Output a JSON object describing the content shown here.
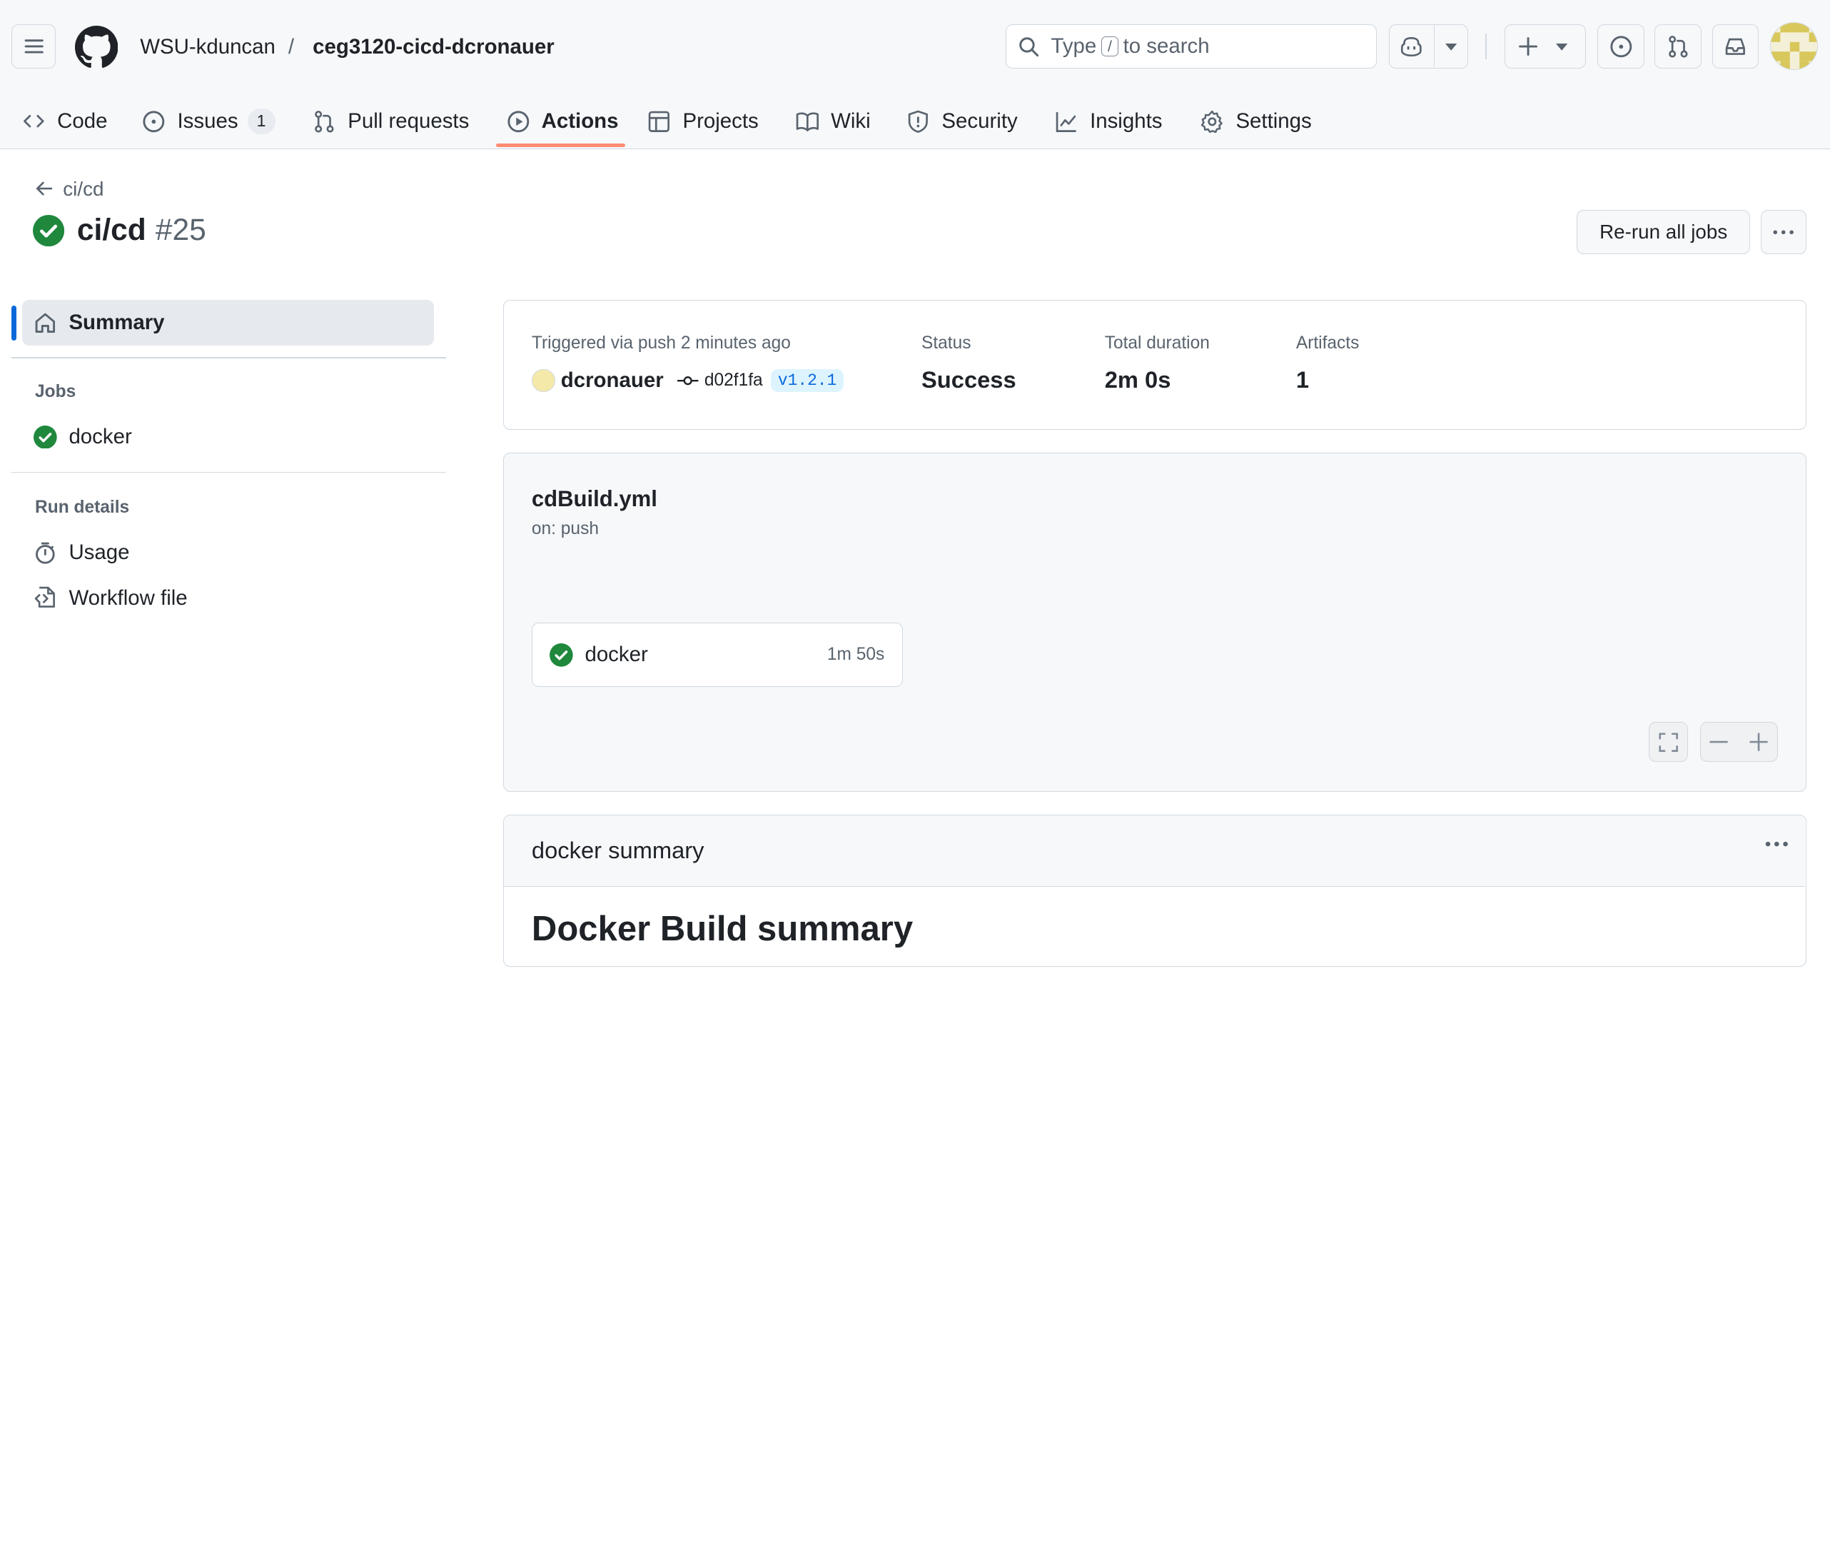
{
  "header": {
    "owner": "WSU-kduncan",
    "separator": "/",
    "repo": "ceg3120-cicd-dcronauer",
    "search": {
      "prefix": "Type",
      "key": "/",
      "suffix": "to search"
    }
  },
  "tabs": [
    {
      "label": "Code",
      "icon": "code-icon"
    },
    {
      "label": "Issues",
      "icon": "issue-opened-icon",
      "count": "1"
    },
    {
      "label": "Pull requests",
      "icon": "git-pull-request-icon"
    },
    {
      "label": "Actions",
      "icon": "play-icon",
      "active": true
    },
    {
      "label": "Projects",
      "icon": "table-icon"
    },
    {
      "label": "Wiki",
      "icon": "book-icon"
    },
    {
      "label": "Security",
      "icon": "shield-icon"
    },
    {
      "label": "Insights",
      "icon": "graph-icon"
    },
    {
      "label": "Settings",
      "icon": "gear-icon"
    }
  ],
  "run": {
    "back_label": "ci/cd",
    "title": "ci/cd",
    "number": "#25",
    "rerun_label": "Re-run all jobs"
  },
  "sidebar": {
    "summary_label": "Summary",
    "jobs_heading": "Jobs",
    "jobs": [
      {
        "label": "docker",
        "status": "success"
      }
    ],
    "run_details_heading": "Run details",
    "details": [
      {
        "label": "Usage",
        "icon": "stopwatch-icon"
      },
      {
        "label": "Workflow file",
        "icon": "file-code-icon"
      }
    ]
  },
  "summary": {
    "triggered_label": "Triggered via push 2 minutes ago",
    "actor": "dcronauer",
    "commit": "d02f1fa",
    "tag": "v1.2.1",
    "status_label": "Status",
    "status_value": "Success",
    "duration_label": "Total duration",
    "duration_value": "2m 0s",
    "artifacts_label": "Artifacts",
    "artifacts_value": "1"
  },
  "workflow": {
    "file": "cdBuild.yml",
    "on": "on: push",
    "job_name": "docker",
    "job_duration": "1m 50s"
  },
  "job_summary": {
    "heading": "docker summary",
    "big_title": "Docker Build summary"
  },
  "colors": {
    "success": "#1f883d",
    "accent": "#0969da",
    "tab_underline": "#fd8c73"
  }
}
